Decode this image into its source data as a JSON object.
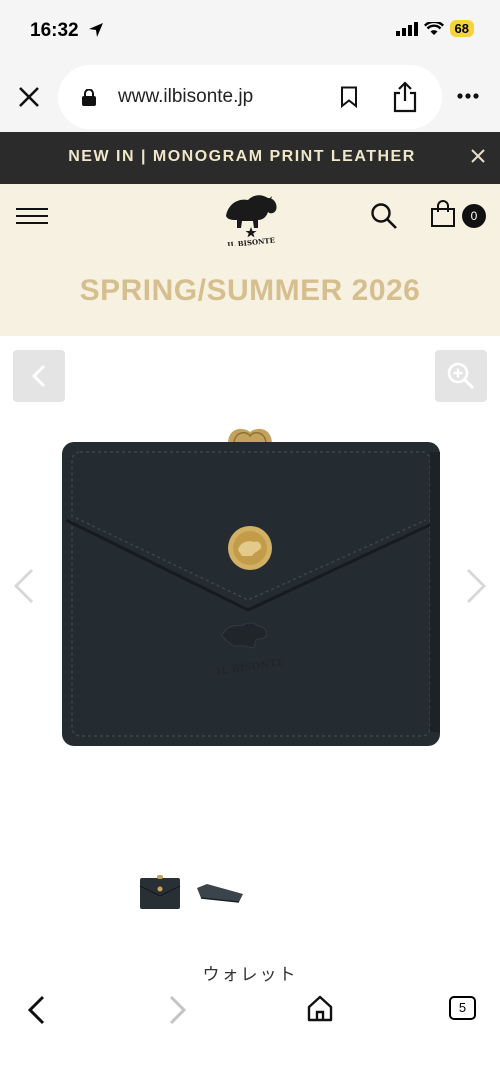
{
  "status_bar": {
    "time": "16:32",
    "battery": "68"
  },
  "browser": {
    "url": "www.ilbisonte.jp"
  },
  "announcement": {
    "text": "NEW IN | MONOGRAM PRINT LEATHER"
  },
  "header": {
    "cart_count": "0",
    "season_title": "SPRING/SUMMER 2026"
  },
  "product": {
    "name": "ウォレット"
  },
  "toolbar": {
    "tab_count": "5"
  },
  "colors": {
    "announcement_bg": "#2b2b2b",
    "header_bg": "#f7f1e2",
    "gold_accent": "#d6bf8f",
    "wallet_leather": "#283036"
  }
}
